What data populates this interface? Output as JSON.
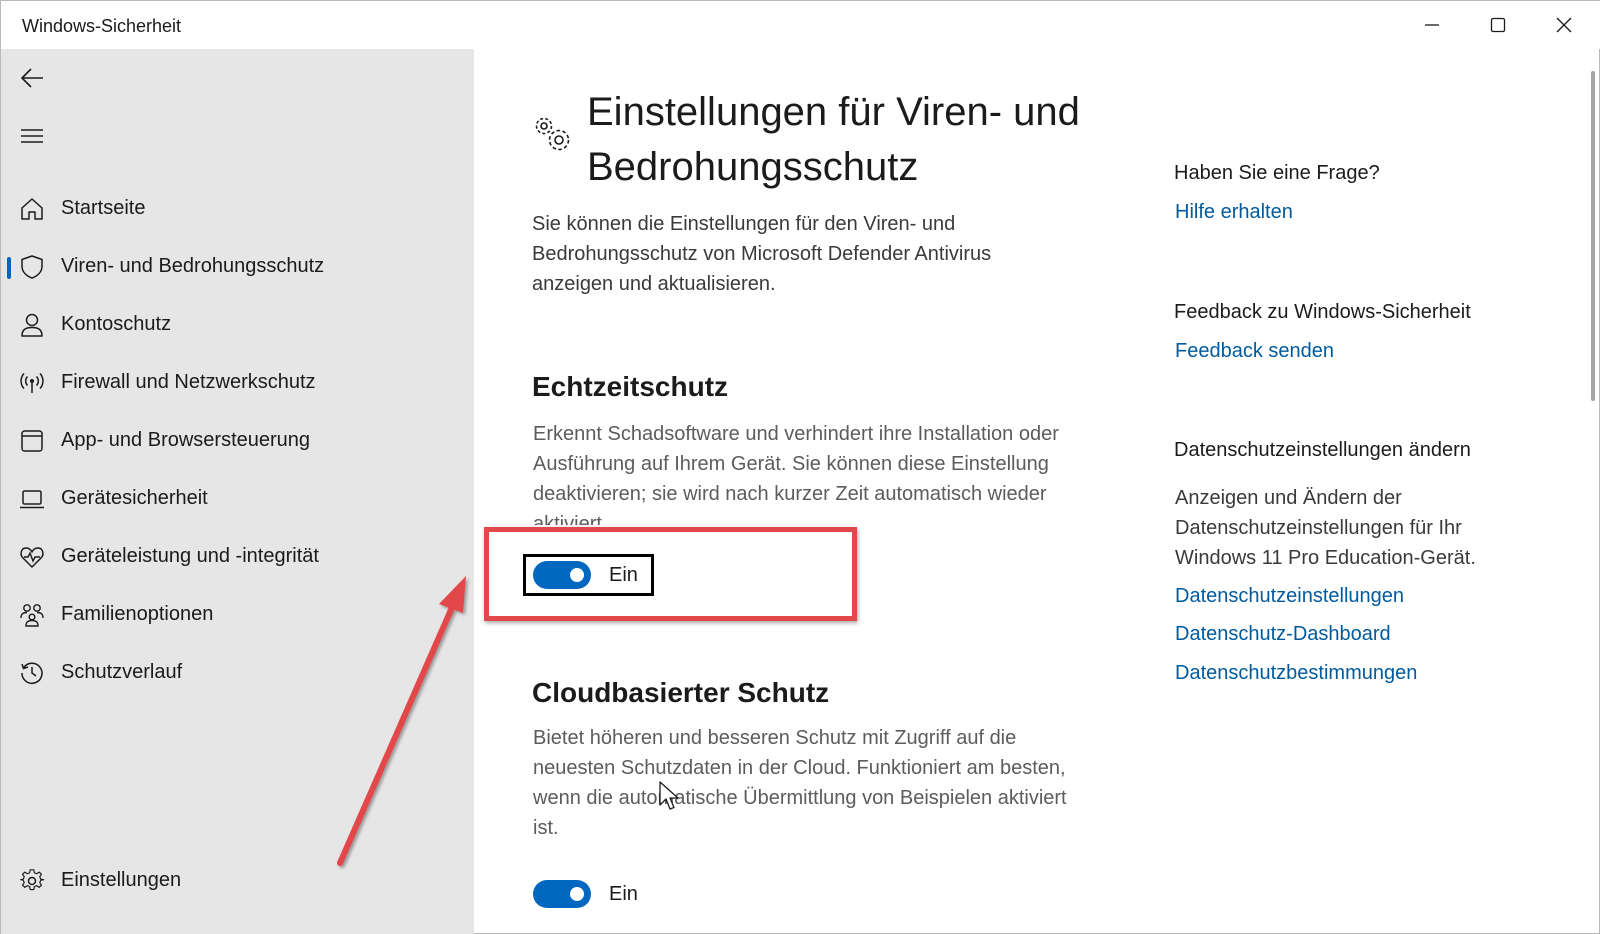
{
  "window": {
    "title": "Windows-Sicherheit"
  },
  "sidebar": {
    "items": [
      {
        "label": "Startseite",
        "icon": "home-icon"
      },
      {
        "label": "Viren- und Bedrohungsschutz",
        "icon": "shield-icon",
        "selected": true
      },
      {
        "label": "Kontoschutz",
        "icon": "person-icon"
      },
      {
        "label": "Firewall und Netzwerkschutz",
        "icon": "antenna-icon"
      },
      {
        "label": "App- und Browsersteuerung",
        "icon": "app-window-icon"
      },
      {
        "label": "Gerätesicherheit",
        "icon": "laptop-icon"
      },
      {
        "label": "Geräteleistung und -integrität",
        "icon": "heart-pulse-icon"
      },
      {
        "label": "Familienoptionen",
        "icon": "family-icon"
      },
      {
        "label": "Schutzverlauf",
        "icon": "history-icon"
      }
    ],
    "settings_label": "Einstellungen"
  },
  "main": {
    "title": "Einstellungen für Viren- und Bedrohungsschutz",
    "description": "Sie können die Einstellungen für den Viren- und Bedrohungsschutz von Microsoft Defender Antivirus anzeigen und aktualisieren.",
    "realtime": {
      "title": "Echtzeitschutz",
      "description": "Erkennt Schadsoftware und verhindert ihre Installation oder Ausführung auf Ihrem Gerät. Sie können diese Einstellung deaktivieren; sie wird nach kurzer Zeit automatisch wieder aktiviert.",
      "toggle_label": "Ein"
    },
    "cloud": {
      "title": "Cloudbasierter Schutz",
      "description": "Bietet höheren und besseren Schutz mit Zugriff auf die neuesten Schutzdaten in der Cloud. Funktioniert am besten, wenn die automatische Übermittlung von Beispielen aktiviert ist.",
      "toggle_label": "Ein"
    }
  },
  "aside": {
    "question_heading": "Haben Sie eine Frage?",
    "help_link": "Hilfe erhalten",
    "feedback_heading": "Feedback zu Windows-Sicherheit",
    "feedback_link": "Feedback senden",
    "privacy_heading": "Datenschutzeinstellungen ändern",
    "privacy_text": "Anzeigen und Ändern der Datenschutzeinstellungen für Ihr Windows 11 Pro Education-Gerät.",
    "privacy_links": [
      "Datenschutzeinstellungen",
      "Datenschutz-Dashboard",
      "Datenschutzbestimmungen"
    ]
  },
  "colors": {
    "accent": "#0067c0",
    "link": "#005a9e",
    "sidebar_bg": "#e6e6e6",
    "annotation": "#e2474a"
  }
}
